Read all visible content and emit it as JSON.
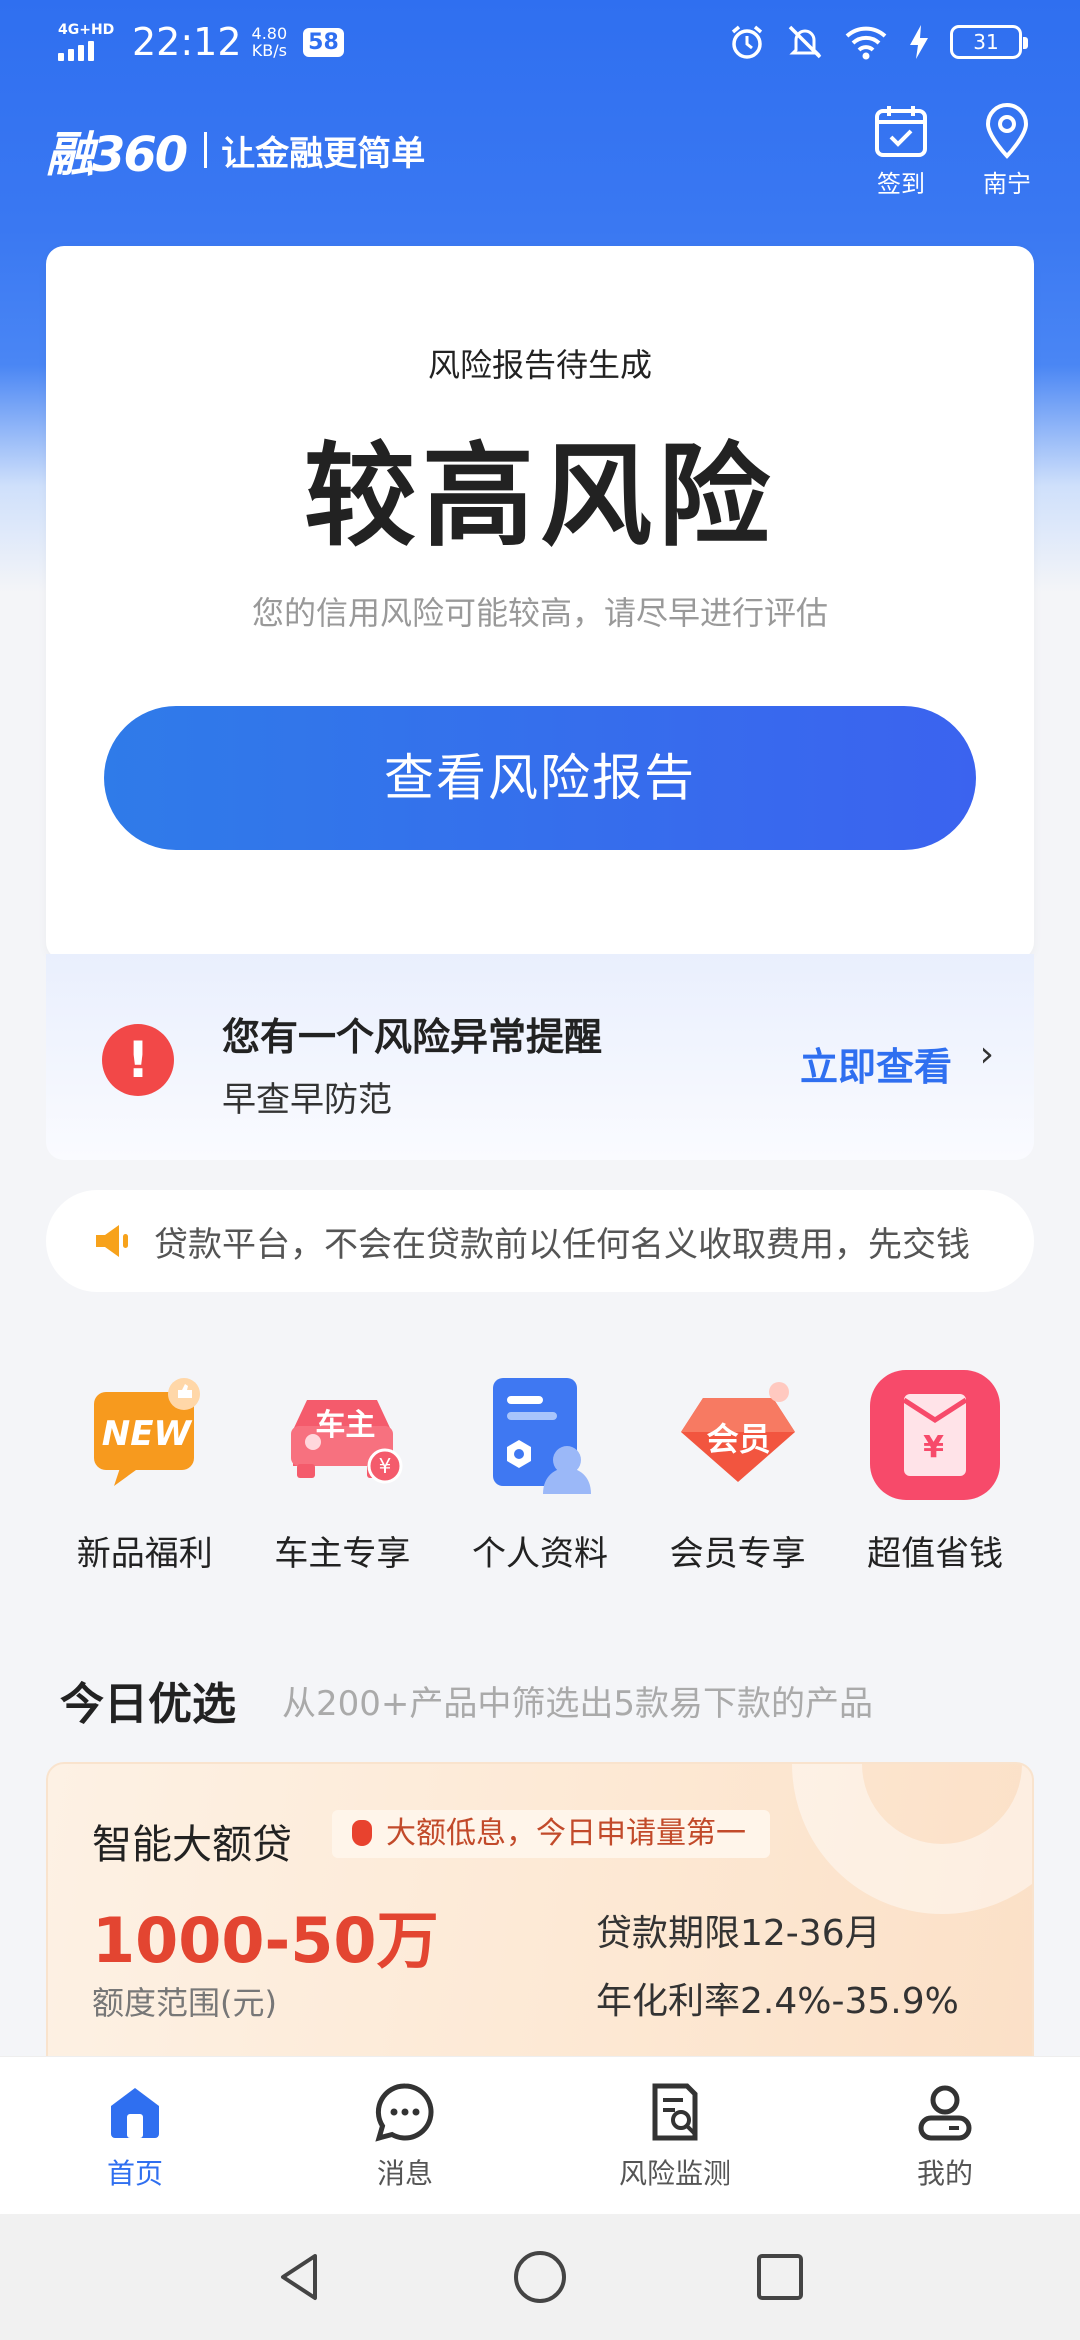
{
  "status_bar": {
    "network": "4G+HD",
    "time": "22:12",
    "speed_value": "4.80",
    "speed_unit": "KB/s",
    "badge": "58",
    "battery": "31"
  },
  "header": {
    "logo": "融360",
    "slogan": "让金融更简单",
    "checkin_label": "签到",
    "location_label": "南宁"
  },
  "risk_card": {
    "subtitle": "风险报告待生成",
    "title": "较高风险",
    "description": "您的信用风险可能较高，请尽早进行评估",
    "button_label": "查看风险报告"
  },
  "alert": {
    "icon": "!",
    "title": "您有一个风险异常提醒",
    "subtitle": "早查早防范",
    "link_label": "立即查看",
    "chevron": "›"
  },
  "notice": {
    "text": "贷款平台，不会在贷款前以任何名义收取费用，先交钱"
  },
  "quick_actions": [
    {
      "label": "新品福利",
      "icon": "new-icon",
      "icon_text": "NEW"
    },
    {
      "label": "车主专享",
      "icon": "car-icon",
      "icon_text": "车主"
    },
    {
      "label": "个人资料",
      "icon": "profile-doc-icon",
      "icon_text": ""
    },
    {
      "label": "会员专享",
      "icon": "member-icon",
      "icon_text": "会员"
    },
    {
      "label": "超值省钱",
      "icon": "red-envelope-icon",
      "icon_text": "¥"
    }
  ],
  "today": {
    "title": "今日优选",
    "subtitle": "从200+产品中筛选出5款易下款的产品"
  },
  "product": {
    "name": "智能大额贷",
    "tag": "大额低息，今日申请量第一",
    "amount": "1000-50万",
    "amount_label": "额度范围(元)",
    "term": "贷款期限12-36月",
    "rate": "年化利率2.4%-35.9%"
  },
  "bottom_nav": [
    {
      "label": "首页",
      "icon": "home-icon",
      "active": true
    },
    {
      "label": "消息",
      "icon": "message-icon",
      "active": false
    },
    {
      "label": "风险监测",
      "icon": "risk-monitor-icon",
      "active": false
    },
    {
      "label": "我的",
      "icon": "profile-icon",
      "active": false
    }
  ],
  "colors": {
    "primary": "#2f6ff0",
    "danger": "#f24848",
    "amount": "#e34531"
  }
}
